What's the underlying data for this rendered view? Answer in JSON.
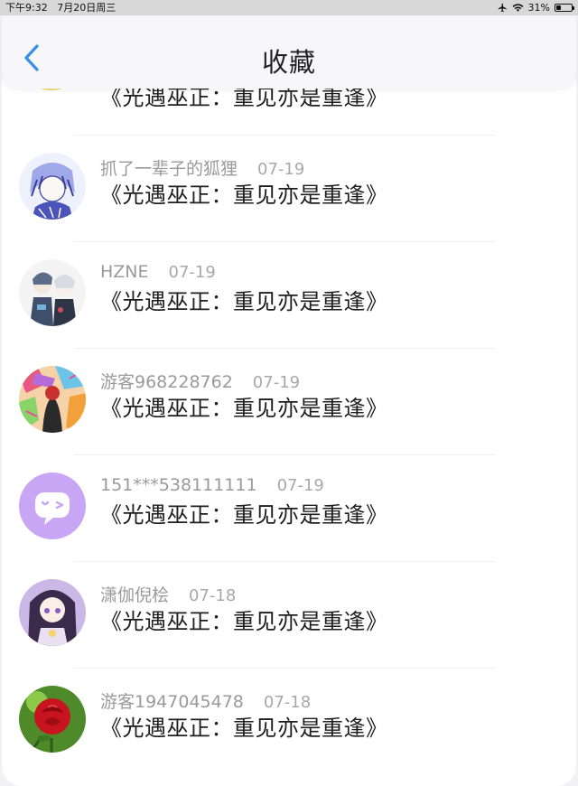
{
  "status_bar": {
    "time": "下午9:32",
    "date": "7月20日周三",
    "battery": "31%",
    "battery_level": 0.31
  },
  "header": {
    "title": "收藏"
  },
  "top_partial_item": {
    "text": "《光遇巫正：重见亦是重逢》"
  },
  "items": [
    {
      "user": "抓了一辈子的狐狸",
      "date": "07-19",
      "text": "《光遇巫正：重见亦是重逢》",
      "avatar": "anime-avatar-icon"
    },
    {
      "user": "HZNE",
      "date": "07-19",
      "text": "《光遇巫正：重见亦是重逢》",
      "avatar": "anime-duo-avatar-icon"
    },
    {
      "user": "游客968228762",
      "date": "07-19",
      "text": "《光遇巫正：重见亦是重逢》",
      "avatar": "colorful-avatar-icon"
    },
    {
      "user": "151***538111111",
      "date": "07-19",
      "text": "《光遇巫正：重见亦是重逢》",
      "avatar": "chat-bubble-avatar-icon"
    },
    {
      "user": "潇伽倪桧",
      "date": "07-18",
      "text": "《光遇巫正：重见亦是重逢》",
      "avatar": "anime-girl-avatar-icon"
    },
    {
      "user": "游客1947045478",
      "date": "07-18",
      "text": "《光遇巫正：重见亦是重逢》",
      "avatar": "rose-avatar-icon"
    }
  ],
  "colors": {
    "accent": "#3a8ee6",
    "chat_avatar_bg": "#c9a6f5"
  }
}
